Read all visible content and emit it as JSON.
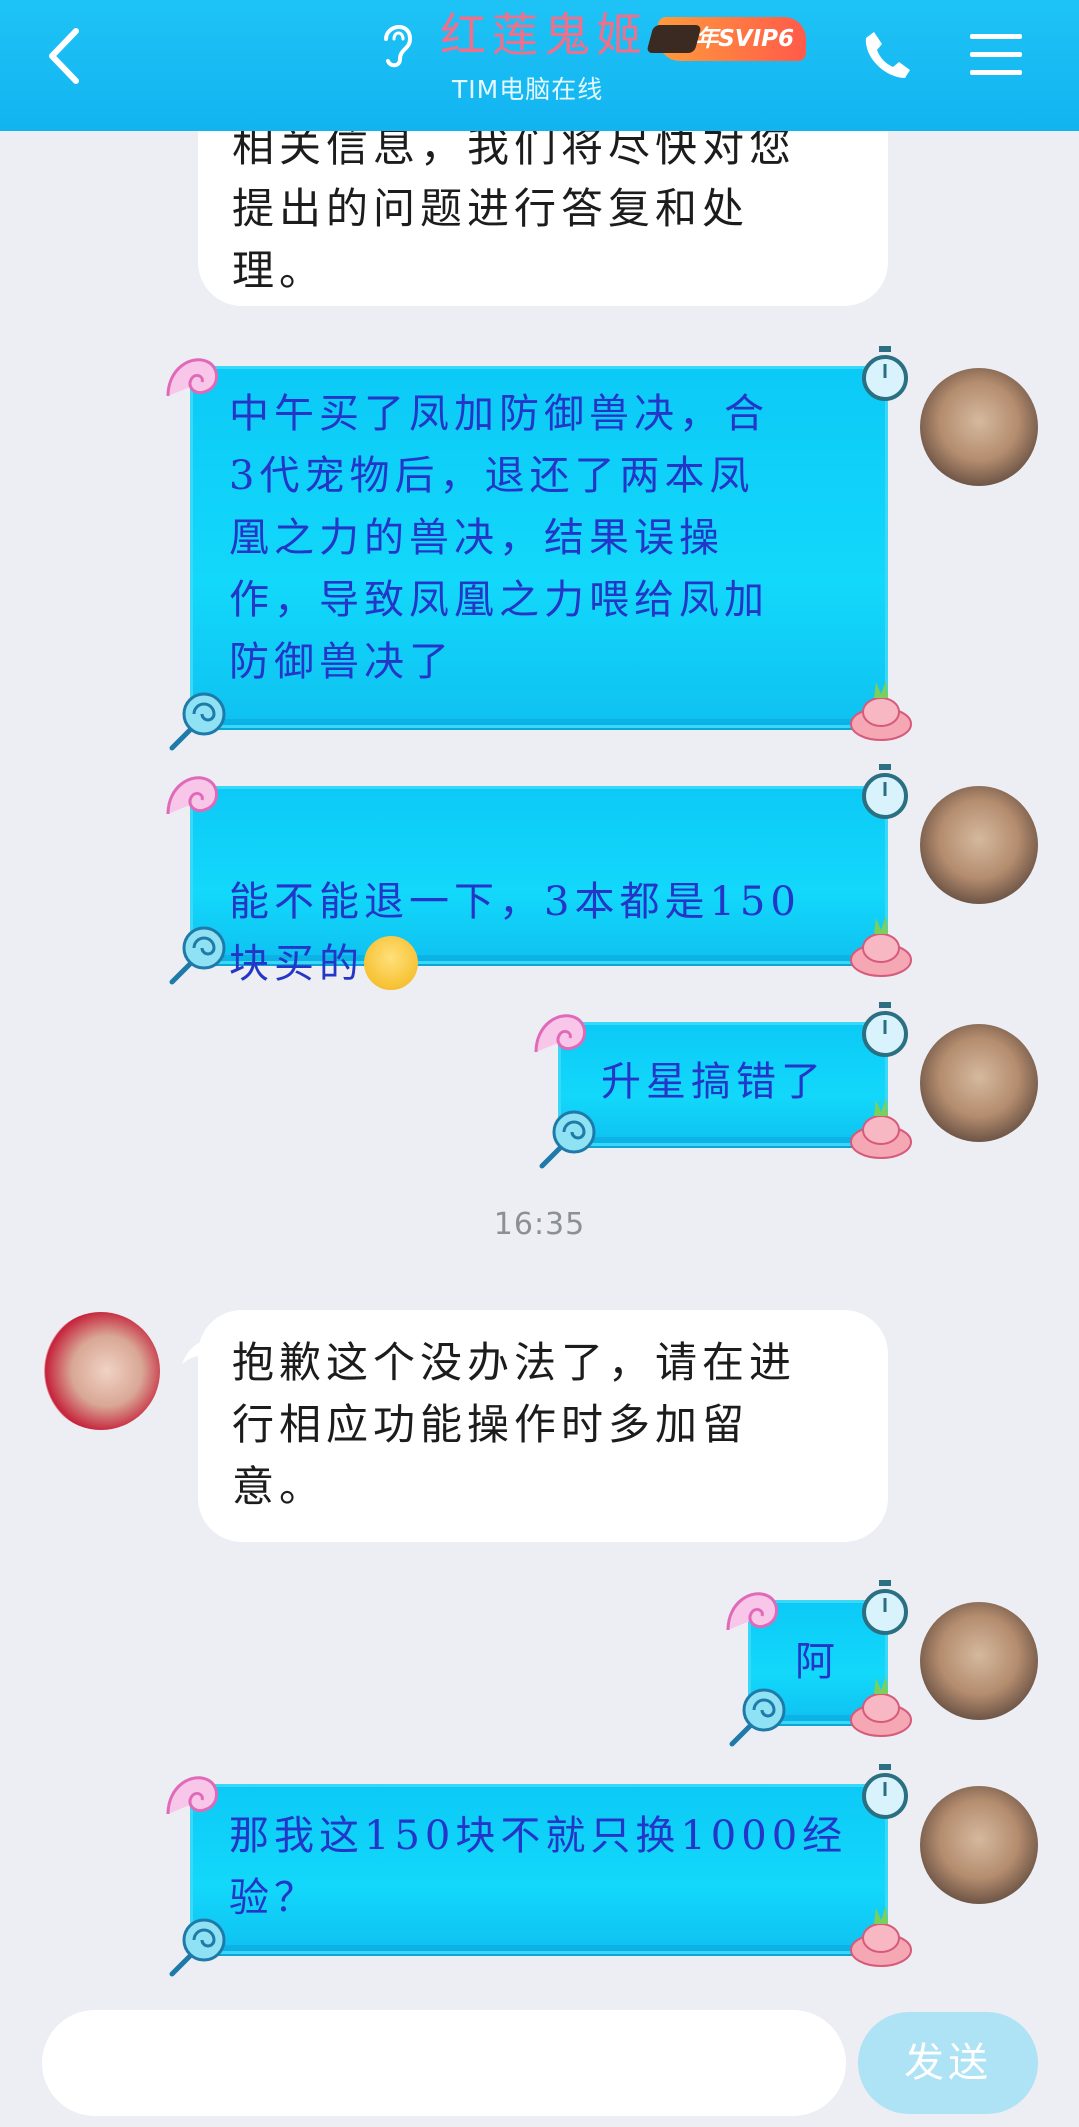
{
  "header": {
    "contact_name": "红莲鬼姬",
    "vip_badge": "年SVIP6",
    "status": "TIM电脑在线"
  },
  "messages": [
    {
      "from": "other",
      "text": "相关信息，我们将尽快对您\n提出的问题进行答复和处\n理。"
    },
    {
      "from": "me",
      "text": "中午买了凤加防御兽决，合\n3代宠物后，退还了两本凤\n凰之力的兽决，结果误操\n作，导致凤凰之力喂给凤加\n防御兽决了"
    },
    {
      "from": "me",
      "text": "能不能退一下，3本都是150\n块买的",
      "emoji": "scared-emoji"
    },
    {
      "from": "me",
      "text": "升星搞错了"
    },
    {
      "type": "time",
      "text": "16:35"
    },
    {
      "from": "other",
      "text": "抱歉这个没办法了，请在进\n行相应功能操作时多加留\n意。"
    },
    {
      "from": "me",
      "text": "阿"
    },
    {
      "from": "me",
      "text": "那我这150块不就只换1000经\n验？"
    }
  ],
  "input": {
    "placeholder": "",
    "send_label": "发送"
  },
  "colors": {
    "header": "#12b4f0",
    "bubble_blue": "#12d8fb",
    "bubble_text": "#2436c8",
    "name_pink": "#f06f8b",
    "send_button": "#aee3f5"
  }
}
